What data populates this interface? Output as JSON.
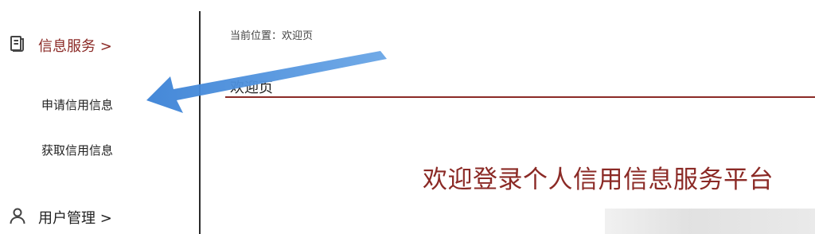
{
  "sidebar": {
    "info_section": {
      "label": "信息服务 >",
      "icon": "document-icon"
    },
    "items": [
      {
        "label": "申请信用信息"
      },
      {
        "label": "获取信用信息"
      }
    ],
    "user_section": {
      "label": "用户管理 >",
      "icon": "user-icon"
    }
  },
  "main": {
    "breadcrumb": {
      "prefix": "当前位置：",
      "current": "欢迎页"
    },
    "page_title": "欢迎页",
    "welcome_text": "欢迎登录个人信用信息服务平台"
  },
  "colors": {
    "accent": "#8b2a26",
    "arrow": "#4a90d9"
  }
}
